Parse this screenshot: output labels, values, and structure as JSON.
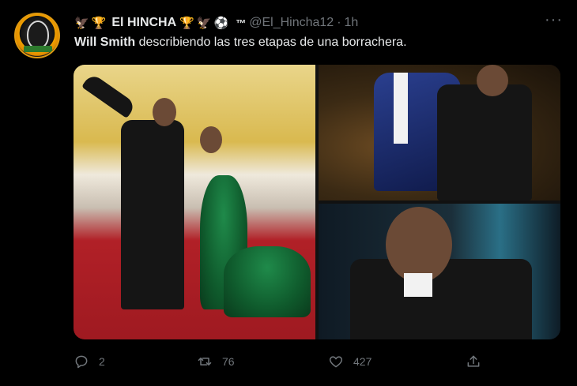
{
  "tweet": {
    "author_name": "El HINCHA",
    "handle": "@El_Hincha12",
    "separator": "·",
    "time": "1h",
    "tm": "™",
    "emojis_left": [
      "🦅",
      "🏆"
    ],
    "emojis_right": [
      "🏆",
      "🦅",
      "⚽"
    ],
    "text_bold": "Will Smith",
    "text_rest": " describiendo las tres etapas de una borrachera.",
    "more_label": "···"
  },
  "actions": {
    "reply_count": "2",
    "retweet_count": "76",
    "like_count": "427"
  },
  "icons": {
    "reply": "reply-icon",
    "retweet": "retweet-icon",
    "like": "heart-icon",
    "share": "share-icon",
    "more": "more-icon"
  }
}
